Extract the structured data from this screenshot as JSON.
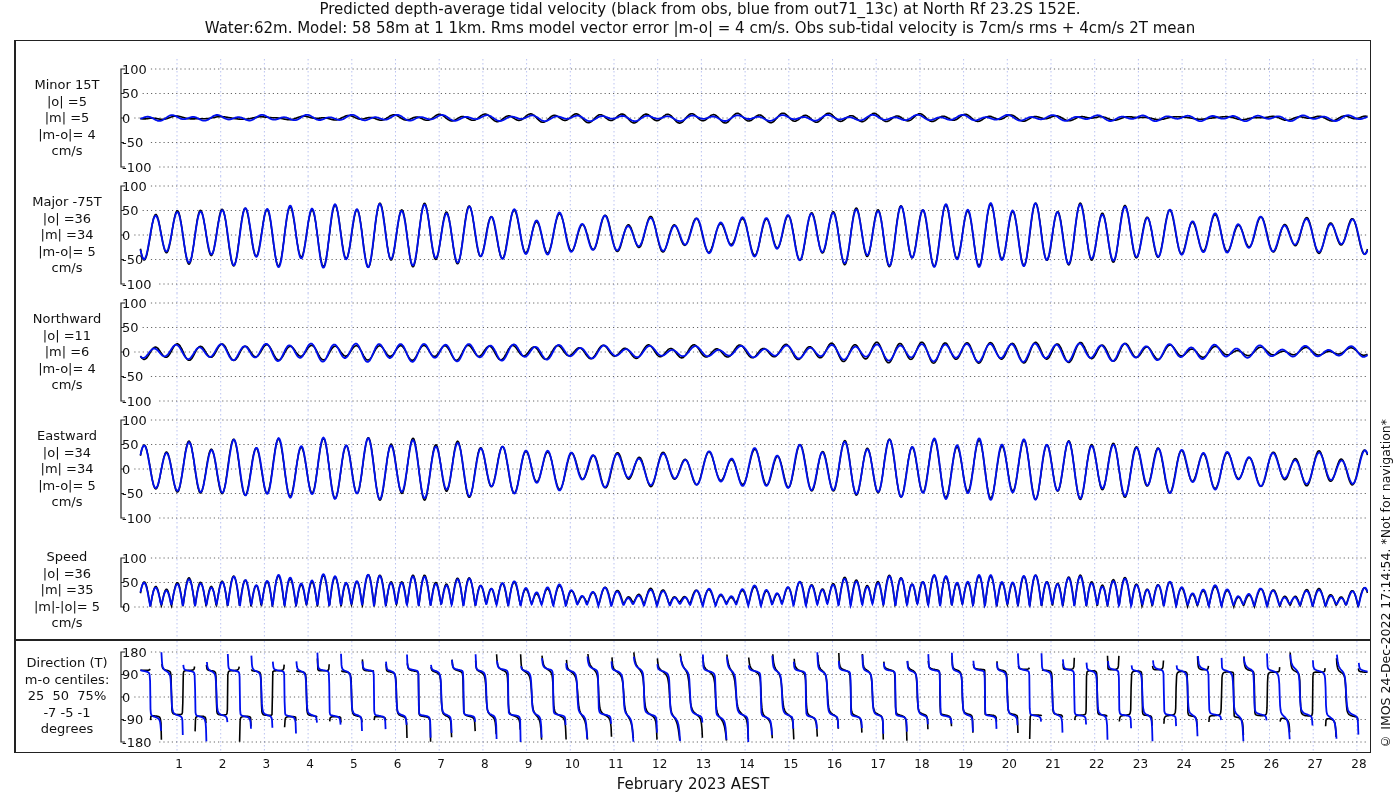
{
  "title": [
    "Predicted depth-average tidal velocity (black from obs, blue from out71_13c) at North Rf 23.2S 152E.",
    "Water:62m. Model: 58 58m at 1 1km. Rms model vector error |m-o| = 4 cm/s. Obs sub-tidal velocity is 7cm/s rms + 4cm/s 2T mean"
  ],
  "panels": [
    {
      "kind": "minor",
      "label": [
        "Minor 15T",
        "|o| =5",
        "|m| =5",
        "|m-o|= 4",
        "cm/s"
      ],
      "yticks": [
        "100",
        "50",
        "0",
        "-50",
        "-100"
      ]
    },
    {
      "kind": "major",
      "label": [
        "Major -75T",
        "|o| =36",
        "|m| =34",
        "|m-o|= 5",
        "cm/s"
      ],
      "yticks": [
        "100",
        "50",
        "0",
        "-50",
        "-100"
      ]
    },
    {
      "kind": "northward",
      "label": [
        "Northward",
        "|o| =11",
        "|m| =6",
        "|m-o|= 4",
        "cm/s"
      ],
      "yticks": [
        "100",
        "50",
        "0",
        "-50",
        "-100"
      ]
    },
    {
      "kind": "eastward",
      "label": [
        "Eastward",
        "|o| =34",
        "|m| =34",
        "|m-o|= 5",
        "cm/s"
      ],
      "yticks": [
        "100",
        "50",
        "0",
        "-50",
        "-100"
      ]
    },
    {
      "kind": "speed",
      "label": [
        "Speed",
        "|o| =36",
        "|m| =35",
        "|m|-|o|= 5",
        "cm/s"
      ],
      "yticks": [
        "100",
        "50",
        "0"
      ]
    }
  ],
  "direction_panel": {
    "kind": "direction",
    "label": [
      "Direction (T)",
      "m-o centiles:",
      "25  50  75%",
      "-7 -5 -1",
      "degrees"
    ],
    "yticks": [
      "180",
      "90",
      "0",
      "-90",
      "-180"
    ]
  },
  "xticks": [
    "1",
    "2",
    "3",
    "4",
    "5",
    "6",
    "7",
    "8",
    "9",
    "10",
    "11",
    "12",
    "13",
    "14",
    "15",
    "16",
    "17",
    "18",
    "19",
    "20",
    "21",
    "22",
    "23",
    "24",
    "25",
    "26",
    "27",
    "28"
  ],
  "xlabel": "February 2023 AEST",
  "footer": "© IMOS 24-Dec-2022 17:14:54.  *Not for navigation*"
}
